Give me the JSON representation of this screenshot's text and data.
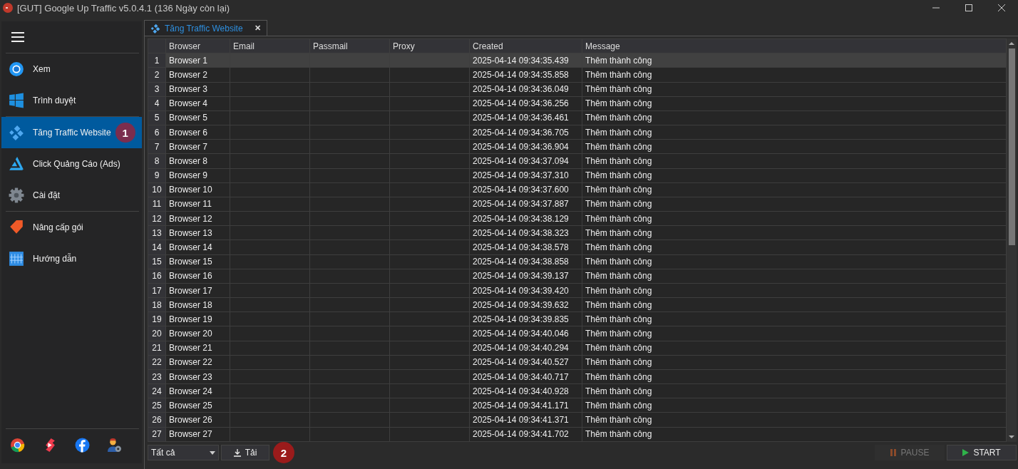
{
  "window": {
    "title": "[GUT] Google Up Traffic v5.0.4.1 (136 Ngày còn lại)"
  },
  "sidebar": {
    "groups": [
      [
        {
          "label": "Xem",
          "selected": false
        },
        {
          "label": "Trình duyệt",
          "selected": false
        }
      ],
      [
        {
          "label": "Tăng Traffic Website",
          "selected": true,
          "badge": "1"
        },
        {
          "label": "Click Quảng Cáo (Ads)",
          "selected": false
        },
        {
          "label": "Cài đặt",
          "selected": false
        }
      ],
      [
        {
          "label": "Nâng cấp gói",
          "selected": false
        },
        {
          "label": "Hướng dẫn",
          "selected": false
        }
      ]
    ]
  },
  "tabs": [
    {
      "label": "Tăng Traffic Website",
      "selected": true,
      "close": "✕"
    }
  ],
  "table": {
    "columns": [
      "Browser",
      "Email",
      "Passmail",
      "Proxy",
      "Created",
      "Message"
    ],
    "rows": [
      {
        "n": "1",
        "browser": "Browser 1",
        "created": "2025-04-14 09:34:35.439",
        "message": "Thêm thành công",
        "selected": true
      },
      {
        "n": "2",
        "browser": "Browser 2",
        "created": "2025-04-14 09:34:35.858",
        "message": "Thêm thành công",
        "selected": false
      },
      {
        "n": "3",
        "browser": "Browser 3",
        "created": "2025-04-14 09:34:36.049",
        "message": "Thêm thành công",
        "selected": false
      },
      {
        "n": "4",
        "browser": "Browser 4",
        "created": "2025-04-14 09:34:36.256",
        "message": "Thêm thành công",
        "selected": false
      },
      {
        "n": "5",
        "browser": "Browser 5",
        "created": "2025-04-14 09:34:36.461",
        "message": "Thêm thành công",
        "selected": false
      },
      {
        "n": "6",
        "browser": "Browser 6",
        "created": "2025-04-14 09:34:36.705",
        "message": "Thêm thành công",
        "selected": false
      },
      {
        "n": "7",
        "browser": "Browser 7",
        "created": "2025-04-14 09:34:36.904",
        "message": "Thêm thành công",
        "selected": false
      },
      {
        "n": "8",
        "browser": "Browser 8",
        "created": "2025-04-14 09:34:37.094",
        "message": "Thêm thành công",
        "selected": false
      },
      {
        "n": "9",
        "browser": "Browser 9",
        "created": "2025-04-14 09:34:37.310",
        "message": "Thêm thành công",
        "selected": false
      },
      {
        "n": "10",
        "browser": "Browser 10",
        "created": "2025-04-14 09:34:37.600",
        "message": "Thêm thành công",
        "selected": false
      },
      {
        "n": "11",
        "browser": "Browser 11",
        "created": "2025-04-14 09:34:37.887",
        "message": "Thêm thành công",
        "selected": false
      },
      {
        "n": "12",
        "browser": "Browser 12",
        "created": "2025-04-14 09:34:38.129",
        "message": "Thêm thành công",
        "selected": false
      },
      {
        "n": "13",
        "browser": "Browser 13",
        "created": "2025-04-14 09:34:38.323",
        "message": "Thêm thành công",
        "selected": false
      },
      {
        "n": "14",
        "browser": "Browser 14",
        "created": "2025-04-14 09:34:38.578",
        "message": "Thêm thành công",
        "selected": false
      },
      {
        "n": "15",
        "browser": "Browser 15",
        "created": "2025-04-14 09:34:38.858",
        "message": "Thêm thành công",
        "selected": false
      },
      {
        "n": "16",
        "browser": "Browser 16",
        "created": "2025-04-14 09:34:39.137",
        "message": "Thêm thành công",
        "selected": false
      },
      {
        "n": "17",
        "browser": "Browser 17",
        "created": "2025-04-14 09:34:39.420",
        "message": "Thêm thành công",
        "selected": false
      },
      {
        "n": "18",
        "browser": "Browser 18",
        "created": "2025-04-14 09:34:39.632",
        "message": "Thêm thành công",
        "selected": false
      },
      {
        "n": "19",
        "browser": "Browser 19",
        "created": "2025-04-14 09:34:39.835",
        "message": "Thêm thành công",
        "selected": false
      },
      {
        "n": "20",
        "browser": "Browser 20",
        "created": "2025-04-14 09:34:40.046",
        "message": "Thêm thành công",
        "selected": false
      },
      {
        "n": "21",
        "browser": "Browser 21",
        "created": "2025-04-14 09:34:40.294",
        "message": "Thêm thành công",
        "selected": false
      },
      {
        "n": "22",
        "browser": "Browser 22",
        "created": "2025-04-14 09:34:40.527",
        "message": "Thêm thành công",
        "selected": false
      },
      {
        "n": "23",
        "browser": "Browser 23",
        "created": "2025-04-14 09:34:40.717",
        "message": "Thêm thành công",
        "selected": false
      },
      {
        "n": "24",
        "browser": "Browser 24",
        "created": "2025-04-14 09:34:40.928",
        "message": "Thêm thành công",
        "selected": false
      },
      {
        "n": "25",
        "browser": "Browser 25",
        "created": "2025-04-14 09:34:41.171",
        "message": "Thêm thành công",
        "selected": false
      },
      {
        "n": "26",
        "browser": "Browser 26",
        "created": "2025-04-14 09:34:41.371",
        "message": "Thêm thành công",
        "selected": false
      },
      {
        "n": "27",
        "browser": "Browser 27",
        "created": "2025-04-14 09:34:41.702",
        "message": "Thêm thành công",
        "selected": false
      }
    ]
  },
  "footer": {
    "filter": {
      "value": "Tất cả"
    },
    "download_button": {
      "label": "Tải"
    },
    "extra_badge": "2",
    "buttons": [
      {
        "label": "PAUSE",
        "kind": "pause",
        "disabled": true
      },
      {
        "label": "START",
        "kind": "start",
        "disabled": false
      }
    ]
  }
}
